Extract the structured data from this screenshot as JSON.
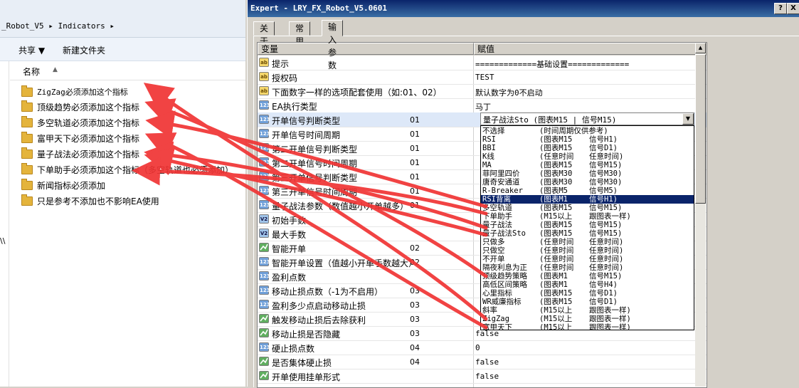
{
  "explorer": {
    "breadcrumb": "_Robot_V5 ▸ Indicators ▸",
    "toolbar": {
      "share": "共享 ▼",
      "new_folder": "新建文件夹"
    },
    "header": {
      "name_col": "名称"
    },
    "nav_glyph": "\\\\",
    "files": [
      "ZigZag必须添加这个指标",
      "顶级趋势必须添加这个指标",
      "多空轨道必须添加这个指标",
      "富甲天下必须添加这个指标",
      "量子战法必须添加这个指标",
      "下单助手必须添加这个指标（多空轨道也必须添加）",
      "新闻指标必须添加",
      "只是参考不添加也不影响EA使用"
    ]
  },
  "dialog": {
    "title": "Expert - LRY_FX_Robot_V5.0601",
    "title_buttons": [
      "?",
      "X"
    ],
    "tabs": [
      "关于",
      "常用",
      "输入参数"
    ],
    "active_tab": 2,
    "columns": {
      "variable": "变量",
      "value": "赋值"
    },
    "rows": [
      {
        "icon": "ab",
        "name": "提示",
        "code": "",
        "value": "=============基础设置============="
      },
      {
        "icon": "ab",
        "name": "授权码",
        "code": "",
        "value": "TEST"
      },
      {
        "icon": "ab",
        "name": "下面数字一样的选项配套使用（如:01、02）",
        "code": "",
        "value": "默认数字为0不启动"
      },
      {
        "icon": "123",
        "name": "EA执行类型",
        "code": "",
        "value": "马丁"
      },
      {
        "icon": "123",
        "name": "开单信号判断类型",
        "code": "01",
        "value": ""
      },
      {
        "icon": "123",
        "name": "开单信号时间周期",
        "code": "01",
        "value": ""
      },
      {
        "icon": "123",
        "name": "第二开单信号判断类型",
        "code": "01",
        "value": ""
      },
      {
        "icon": "123",
        "name": "第二开单信号时间周期",
        "code": "01",
        "value": ""
      },
      {
        "icon": "123",
        "name": "第三开单信号判断类型",
        "code": "01",
        "value": ""
      },
      {
        "icon": "123",
        "name": "第三开单信号时间周期",
        "code": "01",
        "value": ""
      },
      {
        "icon": "123",
        "name": "量子战法参数（数值越小开单越多）",
        "code": "01",
        "value": ""
      },
      {
        "icon": "v2",
        "name": "初始手数",
        "code": "",
        "value": ""
      },
      {
        "icon": "v2",
        "name": "最大手数",
        "code": "",
        "value": ""
      },
      {
        "icon": "bool",
        "name": "智能开单",
        "code": "02",
        "value": ""
      },
      {
        "icon": "123",
        "name": "智能开单设置（值越小开单手数越大）",
        "code": "02",
        "value": ""
      },
      {
        "icon": "123",
        "name": "盈利点数",
        "code": "",
        "value": ""
      },
      {
        "icon": "123",
        "name": "移动止损点数（-1为不启用）",
        "code": "03",
        "value": ""
      },
      {
        "icon": "123",
        "name": "盈利多少点启动移动止损",
        "code": "03",
        "value": ""
      },
      {
        "icon": "bool",
        "name": "触发移动止损后去除获利",
        "code": "03",
        "value": ""
      },
      {
        "icon": "bool",
        "name": "移动止损是否隐藏",
        "code": "03",
        "value": "false"
      },
      {
        "icon": "123",
        "name": "硬止损点数",
        "code": "04",
        "value": "0"
      },
      {
        "icon": "bool",
        "name": "是否集体硬止损",
        "code": "04",
        "value": "false"
      },
      {
        "icon": "bool",
        "name": "开单使用挂单形式",
        "code": "",
        "value": "false"
      }
    ],
    "combo": {
      "value": "量子战法Sto   (图表M15  |  信号M15)"
    },
    "dropdown": [
      [
        "不选择",
        "(时间周期仅供参考)",
        ""
      ],
      [
        "RSI",
        "(图表M15",
        "信号H1)"
      ],
      [
        "BBI",
        "(图表M15",
        "信号D1)"
      ],
      [
        "K线",
        "(任意时间",
        "任意时间)"
      ],
      [
        "MA",
        "(图表M15",
        "信号M15)"
      ],
      [
        "菲阿里四价",
        "(图表M30",
        "信号M30)"
      ],
      [
        "唐奇安通道",
        "(图表M30",
        "信号M30)"
      ],
      [
        "R-Breaker",
        "(图表M5",
        "信号M5)"
      ],
      [
        "RSI背离",
        "(图表M1",
        "信号H1)"
      ],
      [
        "多空轨道",
        "(图表M15",
        "信号M15)"
      ],
      [
        "下单助手",
        "(M15以上",
        "跟图表一样)"
      ],
      [
        "量子战法",
        "(图表M15",
        "信号M15)"
      ],
      [
        "量子战法Sto",
        "(图表M15",
        "信号M15)"
      ],
      [
        "只做多",
        "(任意时间",
        "任意时间)"
      ],
      [
        "只做空",
        "(任意时间",
        "任意时间)"
      ],
      [
        "不开单",
        "(任意时间",
        "任意时间)"
      ],
      [
        "隔夜利息为正",
        "(任意时间",
        "任意时间)"
      ],
      [
        "顶级趋势策略",
        "(图表M1",
        "信号M15)"
      ],
      [
        "高低区间策略",
        "(图表M1",
        "信号H4)"
      ],
      [
        "心里指标",
        "(图表M15",
        "信号D1)"
      ],
      [
        "WR威廉指标",
        "(图表M15",
        "信号D1)"
      ],
      [
        "斜率",
        "(M15以上",
        "跟图表一样)"
      ],
      [
        "ZigZag",
        "(M15以上",
        "跟图表一样)"
      ],
      [
        "富甲天下",
        "(M15以上",
        "跟图表一样)"
      ]
    ],
    "selected_dropdown_index": 8
  }
}
